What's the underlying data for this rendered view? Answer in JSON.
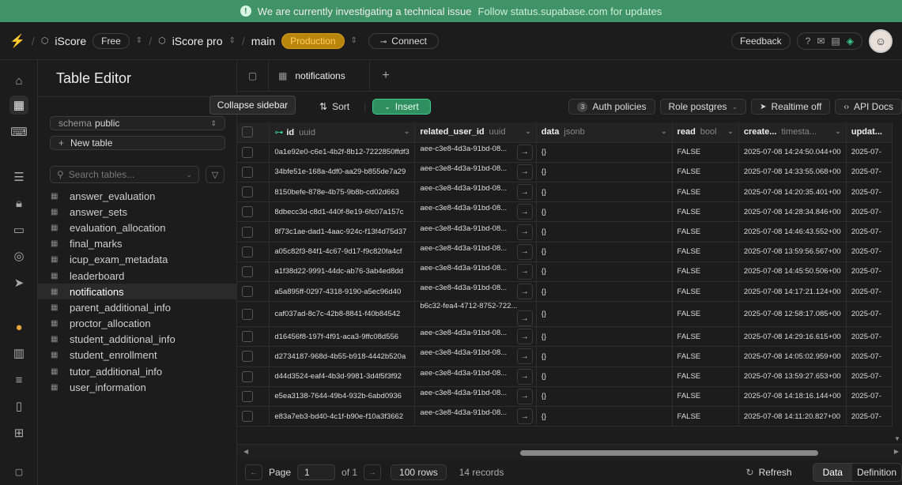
{
  "banner": {
    "message": "We are currently investigating a technical issue",
    "sub": "Follow status.supabase.com for updates"
  },
  "topbar": {
    "org": "iScore",
    "plan": "Free",
    "project": "iScore pro",
    "branch": "main",
    "env": "Production",
    "connect": "Connect",
    "feedback": "Feedback"
  },
  "sidebar": {
    "title": "Table Editor",
    "schema_label": "schema",
    "schema_value": "public",
    "new_table": "New table",
    "search_placeholder": "Search tables...",
    "tables": [
      "answer_evaluation",
      "answer_sets",
      "evaluation_allocation",
      "final_marks",
      "icup_exam_metadata",
      "leaderboard",
      "notifications",
      "parent_additional_info",
      "proctor_allocation",
      "student_additional_info",
      "student_enrollment",
      "tutor_additional_info",
      "user_information"
    ],
    "active": "notifications"
  },
  "tooltip": "Collapse sidebar",
  "tabs": {
    "active": "notifications"
  },
  "toolbar": {
    "sort": "Sort",
    "insert": "Insert",
    "auth": "Auth policies",
    "auth_count": "3",
    "role": "Role postgres",
    "realtime": "Realtime off",
    "api": "API Docs"
  },
  "grid": {
    "columns": [
      {
        "name": "id",
        "type": "uuid"
      },
      {
        "name": "related_user_id",
        "type": "uuid"
      },
      {
        "name": "data",
        "type": "jsonb"
      },
      {
        "name": "read",
        "type": "bool"
      },
      {
        "name": "create...",
        "type": "timesta..."
      },
      {
        "name": "updat...",
        "type": ""
      }
    ],
    "rows": [
      [
        "0a1e92e0-c6e1-4b2f-8b12-7222850ffdf3",
        "aee-c3e8-4d3a-91bd-08...",
        "{}",
        "FALSE",
        "2025-07-08 14:24:50.044+00",
        "2025-07-"
      ],
      [
        "34bfe51e-168a-4df0-aa29-b855de7a29",
        "aee-c3e8-4d3a-91bd-08...",
        "{}",
        "FALSE",
        "2025-07-08 14:33:55.068+00",
        "2025-07-"
      ],
      [
        "8150befe-878e-4b75-9b8b-cd02d663",
        "aee-c3e8-4d3a-91bd-08...",
        "{}",
        "FALSE",
        "2025-07-08 14:20:35.401+00",
        "2025-07-"
      ],
      [
        "8dbecc3d-c8d1-440f-8e19-6fc07a157c",
        "aee-c3e8-4d3a-91bd-08...",
        "{}",
        "FALSE",
        "2025-07-08 14:28:34.846+00",
        "2025-07-"
      ],
      [
        "8f73c1ae-dad1-4aac-924c-f13f4d75d37",
        "aee-c3e8-4d3a-91bd-08...",
        "{}",
        "FALSE",
        "2025-07-08 14:46:43.552+00",
        "2025-07-"
      ],
      [
        "a05c82f3-84f1-4c67-9d17-f9c820fa4cf",
        "aee-c3e8-4d3a-91bd-08...",
        "{}",
        "FALSE",
        "2025-07-08 13:59:56.567+00",
        "2025-07-"
      ],
      [
        "a1f38d22-9991-44dc-ab76-3ab4ed8dd",
        "aee-c3e8-4d3a-91bd-08...",
        "{}",
        "FALSE",
        "2025-07-08 14:45:50.506+00",
        "2025-07-"
      ],
      [
        "a5a895ff-0297-4318-9190-a5ec96d40",
        "aee-c3e8-4d3a-91bd-08...",
        "{}",
        "FALSE",
        "2025-07-08 14:17:21.124+00",
        "2025-07-"
      ],
      [
        "caf037ad-8c7c-42b8-8841-f40b84542",
        "b6c32-fea4-4712-8752-722...",
        "{}",
        "FALSE",
        "2025-07-08 12:58:17.085+00",
        "2025-07-"
      ],
      [
        "d16456f8-197f-4f91-aca3-9ffc08d556",
        "aee-c3e8-4d3a-91bd-08...",
        "{}",
        "FALSE",
        "2025-07-08 14:29:16.615+00",
        "2025-07-"
      ],
      [
        "d2734187-968d-4b55-b918-4442b520a",
        "aee-c3e8-4d3a-91bd-08...",
        "{}",
        "FALSE",
        "2025-07-08 14:05:02.959+00",
        "2025-07-"
      ],
      [
        "d44d3524-eaf4-4b3d-9981-3d4f5f3f92",
        "aee-c3e8-4d3a-91bd-08...",
        "{}",
        "FALSE",
        "2025-07-08 13:59:27.653+00",
        "2025-07-"
      ],
      [
        "e5ea3138-7644-49b4-932b-6abd0936",
        "aee-c3e8-4d3a-91bd-08...",
        "{}",
        "FALSE",
        "2025-07-08 14:18:16.144+00",
        "2025-07-"
      ],
      [
        "e83a7eb3-bd40-4c1f-b90e-f10a3f3662",
        "aee-c3e8-4d3a-91bd-08...",
        "{}",
        "FALSE",
        "2025-07-08 14:11:20.827+00",
        "2025-07-"
      ]
    ]
  },
  "footer": {
    "page_label": "Page",
    "page": "1",
    "of": "of 1",
    "rows": "100 rows",
    "records": "14 records",
    "refresh": "Refresh",
    "data": "Data",
    "definition": "Definition"
  }
}
